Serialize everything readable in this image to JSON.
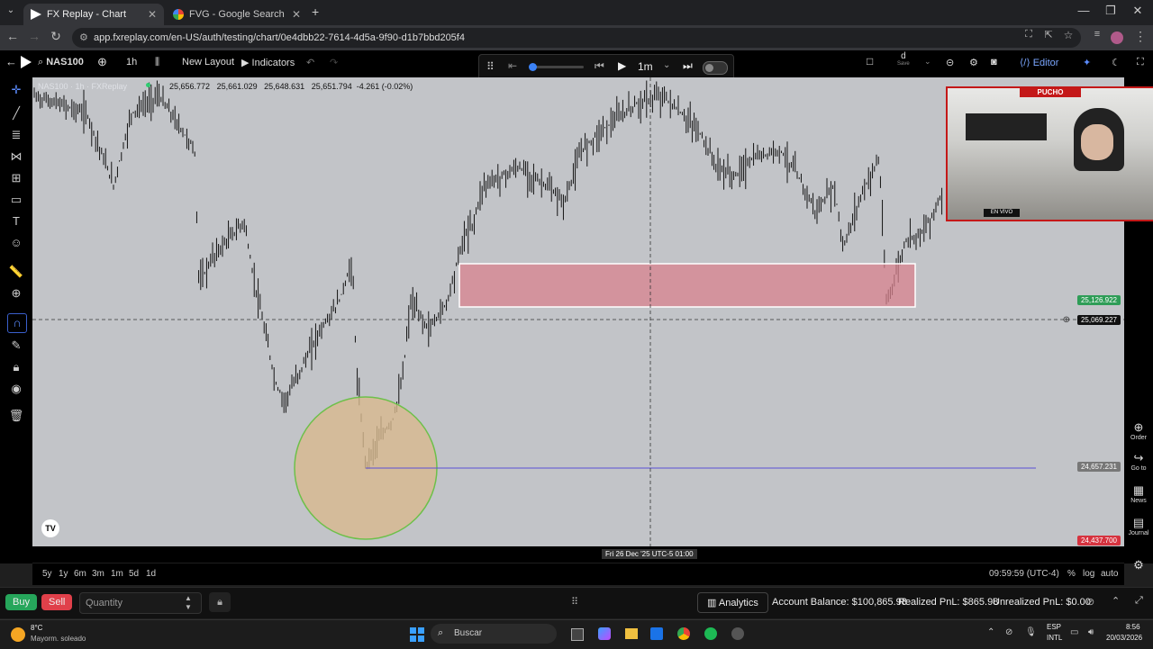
{
  "browser": {
    "tabs": [
      {
        "label": "FX Replay - Chart",
        "active": true
      },
      {
        "label": "FVG - Google Search",
        "active": false
      }
    ],
    "new_tab": "+",
    "url": "app.fxreplay.com/en-US/auth/testing/chart/0e4dbb22-7614-4d5a-9f90-d1b7bbd205f4"
  },
  "toolbar": {
    "symbol": "NAS100",
    "timeframe": "1h",
    "layout_label": "New Layout",
    "indicators_label": "Indicators",
    "editor_label": "Editor",
    "save_label": "Save",
    "save_letter": "d"
  },
  "replay": {
    "interval": "1m",
    "progress": 0.05
  },
  "legend": {
    "title": "NAS100 · 1h · FXReplay",
    "o": "25,656.772",
    "h": "25,661.029",
    "l": "25,648.631",
    "c": "25,651.794",
    "change": "-4.261 (-0.02%)"
  },
  "price_labels": {
    "level_green": "25,126.922",
    "crosshair": "25,069.227",
    "line": "24,657.231",
    "current": "24,437.700"
  },
  "time_axis": {
    "crosshair_time": "Fri 26 Dec '25 UTC-5   01:00"
  },
  "ranges": [
    "5y",
    "1y",
    "6m",
    "3m",
    "1m",
    "5d",
    "1d"
  ],
  "status": {
    "clock": "09:59:59 (UTC-4)",
    "percent": "%",
    "log": "log",
    "auto": "auto"
  },
  "trade": {
    "buy": "Buy",
    "sell": "Sell",
    "quantity_placeholder": "Quantity",
    "analytics": "Analytics",
    "account_balance": "Account Balance: $100,865.98",
    "realized": "Realized PnL: $865.98",
    "unrealized": "Unrealized PnL: $0.00"
  },
  "right_tools": [
    {
      "label": "Order",
      "icon": "plus-circle-icon"
    },
    {
      "label": "Go to",
      "icon": "arrow-right-icon"
    },
    {
      "label": "News",
      "icon": "calendar-icon"
    },
    {
      "label": "Journal",
      "icon": "journal-icon"
    }
  ],
  "webcam": {
    "banner": "PUCHO",
    "live": "EN VIVO"
  },
  "taskbar": {
    "weather_temp": "8°C",
    "weather_desc": "Mayorm. soleado",
    "search": "Buscar",
    "lang": "ESP",
    "lang2": "INTL",
    "time": "8:56",
    "date": "20/03/2026"
  },
  "colors": {
    "zone_fill": "#d8838f",
    "circle_fill": "#d8b98f",
    "circle_stroke": "#6dc04a",
    "label_green": "#2e9d57",
    "label_red": "#d6333f",
    "buy": "#26a65b",
    "sell": "#e0404a"
  }
}
